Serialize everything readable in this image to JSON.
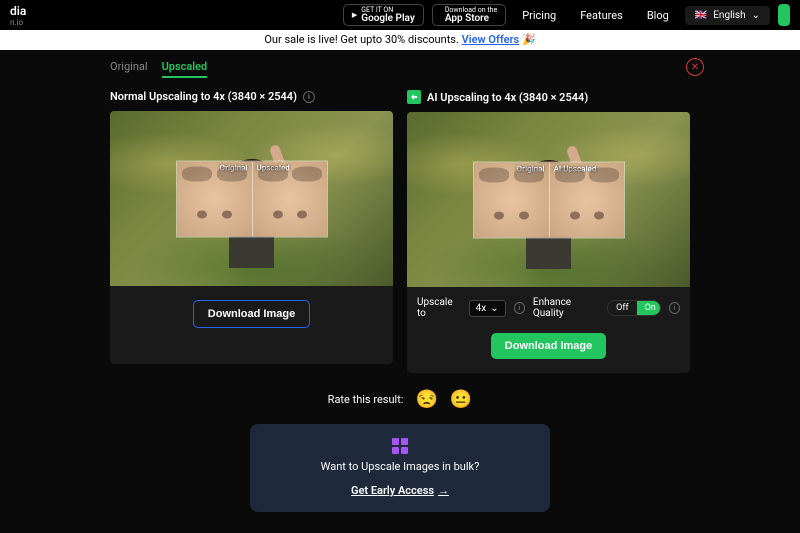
{
  "header": {
    "logo": "dia",
    "logo_sub": "n.io",
    "google_top": "GET IT ON",
    "google_bottom": "Google Play",
    "apple_top": "Download on the",
    "apple_bottom": "App Store",
    "nav": {
      "pricing": "Pricing",
      "features": "Features",
      "blog": "Blog"
    },
    "lang": "English"
  },
  "promo": {
    "text": "Our sale is live! Get upto 30% discounts. ",
    "link": "View Offers",
    "emoji": "🎉"
  },
  "tabs": {
    "original": "Original",
    "upscaled": "Upscaled"
  },
  "left": {
    "title": "Normal Upscaling to 4x (3840 × 2544)",
    "zoom_left": "Original",
    "zoom_right": "Upscaled",
    "download": "Download Image"
  },
  "right": {
    "title": "AI Upscaling to 4x (3840 × 2544)",
    "zoom_left": "Original",
    "zoom_right": "AI Upscaled",
    "upscale_to": "Upscale to",
    "upscale_value": "4x",
    "enhance": "Enhance Quality",
    "off": "Off",
    "on": "On",
    "download": "Download Image"
  },
  "rating": {
    "label": "Rate this result:"
  },
  "bulk": {
    "title": "Want to Upscale Images in bulk?",
    "cta": "Get Early Access"
  }
}
